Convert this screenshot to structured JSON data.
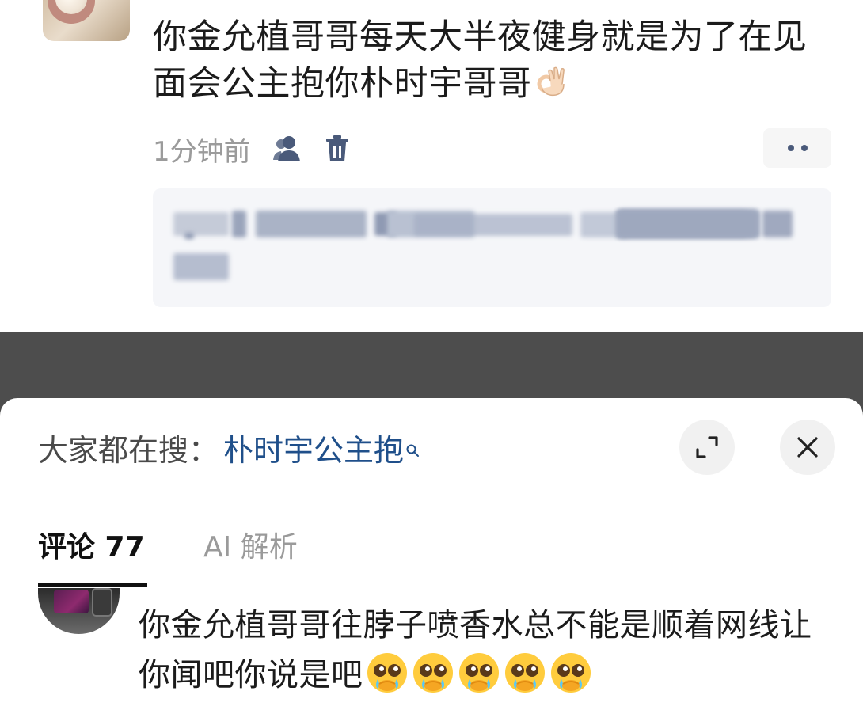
{
  "post": {
    "text": "你金允植哥哥每天大半夜健身就是为了在见面会公主抱你朴时宇哥哥",
    "emoji": "ok-hand-emoji",
    "time": "1分钟前",
    "icons": [
      "user-icon",
      "trash-icon",
      "more-icon"
    ]
  },
  "sheet": {
    "search_prefix": "大家都在搜：",
    "search_term": "朴时宇公主抱",
    "buttons": [
      "expand-icon",
      "close-icon"
    ]
  },
  "tabs": [
    {
      "label": "评论 77",
      "active": true
    },
    {
      "label": "AI 解析",
      "active": false
    }
  ],
  "comment": {
    "text": "你金允植哥哥往脖子喷香水总不能是顺着网线让你闻吧你说是吧",
    "emoji": "pleading-face-emoji",
    "emoji_count": 5
  },
  "colors": {
    "link": "#1f4f8a",
    "icon": "#4a5a7a",
    "muted": "#9b9b9b",
    "dim": "#4d4d4d"
  }
}
